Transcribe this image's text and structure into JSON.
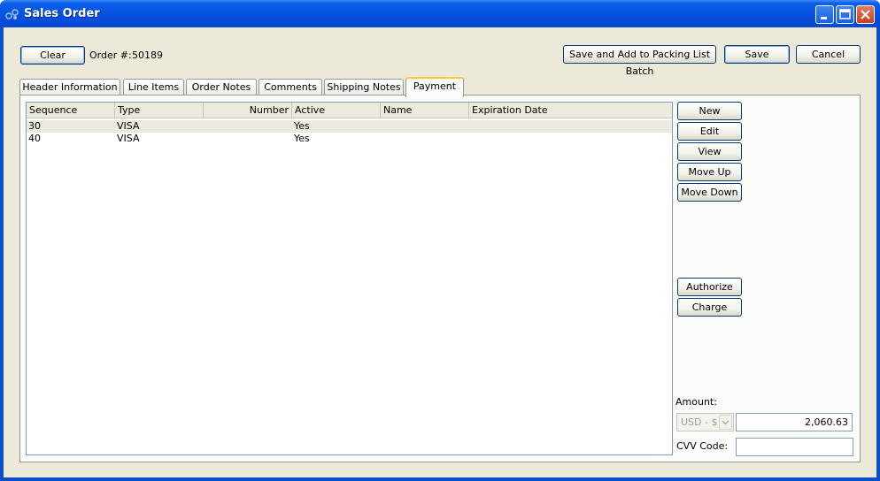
{
  "window": {
    "title": "Sales Order"
  },
  "toolbar": {
    "clear_label": "Clear",
    "order_label": "Order #:",
    "order_number": "50189",
    "save_add_label": "Save and Add to Packing List Batch",
    "save_label": "Save",
    "cancel_label": "Cancel"
  },
  "tabs": [
    {
      "label": "Header Information"
    },
    {
      "label": "Line Items"
    },
    {
      "label": "Order Notes"
    },
    {
      "label": "Comments"
    },
    {
      "label": "Shipping Notes"
    },
    {
      "label": "Payment",
      "active": true
    }
  ],
  "payment_table": {
    "columns": [
      "Sequence",
      "Type",
      "Number",
      "Active",
      "Name",
      "Expiration Date"
    ],
    "rows": [
      {
        "sequence": "30",
        "type": "VISA",
        "number": "",
        "active": "Yes",
        "name": "",
        "expiration": ""
      },
      {
        "sequence": "40",
        "type": "VISA",
        "number": "",
        "active": "Yes",
        "name": "",
        "expiration": ""
      }
    ]
  },
  "side_buttons": {
    "new": "New",
    "edit": "Edit",
    "view": "View",
    "move_up": "Move Up",
    "move_down": "Move Down",
    "authorize": "Authorize",
    "charge": "Charge"
  },
  "amount": {
    "label": "Amount:",
    "currency": "USD - $",
    "value": "2,060.63",
    "cvv_label": "CVV Code:",
    "cvv_value": ""
  }
}
